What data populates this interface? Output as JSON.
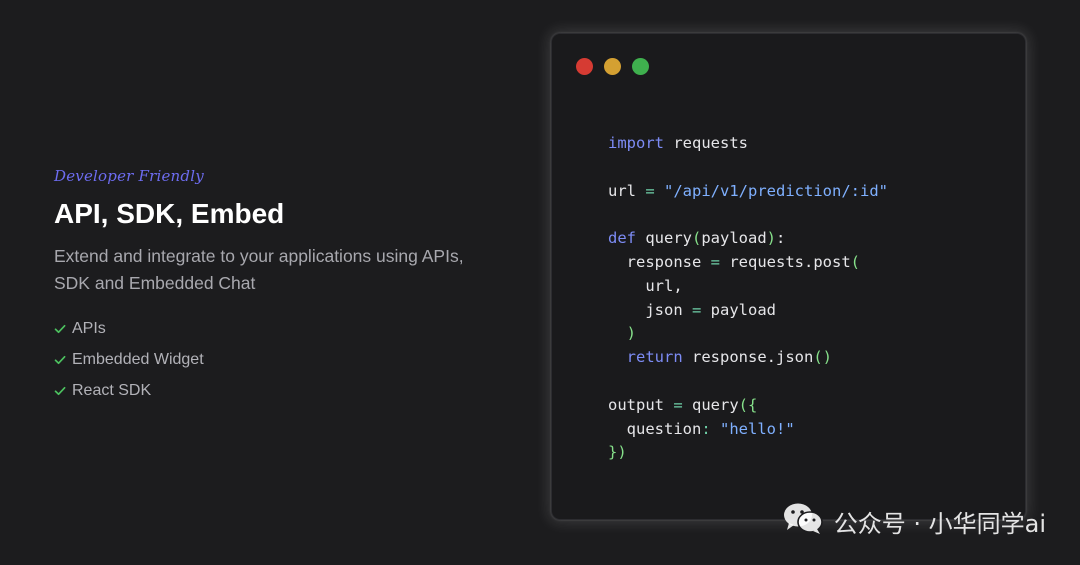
{
  "hero": {
    "eyebrow": "Developer Friendly",
    "title": "API, SDK, Embed",
    "description": "Extend and integrate to your applications using APIs, SDK and Embedded Chat",
    "features": [
      "APIs",
      "Embedded Widget",
      "React SDK"
    ]
  },
  "window": {
    "controls": [
      {
        "name": "close",
        "color": "#d63b33"
      },
      {
        "name": "minimize",
        "color": "#d4a032"
      },
      {
        "name": "maximize",
        "color": "#3fb04e"
      }
    ]
  },
  "code": {
    "lines": [
      [
        {
          "t": "import",
          "c": "kw"
        },
        {
          "t": " requests"
        }
      ],
      [],
      [
        {
          "t": "url "
        },
        {
          "t": "=",
          "c": "op"
        },
        {
          "t": " "
        },
        {
          "t": "\"/api/v1/prediction/:id\"",
          "c": "str"
        }
      ],
      [],
      [
        {
          "t": "def",
          "c": "kw"
        },
        {
          "t": " query"
        },
        {
          "t": "(",
          "c": "br"
        },
        {
          "t": "payload"
        },
        {
          "t": ")",
          "c": "br"
        },
        {
          "t": ":"
        }
      ],
      [
        {
          "t": "  response "
        },
        {
          "t": "=",
          "c": "op"
        },
        {
          "t": " requests.post"
        },
        {
          "t": "(",
          "c": "br"
        }
      ],
      [
        {
          "t": "    url,"
        }
      ],
      [
        {
          "t": "    json "
        },
        {
          "t": "=",
          "c": "op"
        },
        {
          "t": " payload"
        }
      ],
      [
        {
          "t": "  "
        },
        {
          "t": ")",
          "c": "br"
        }
      ],
      [
        {
          "t": "  "
        },
        {
          "t": "return",
          "c": "kw"
        },
        {
          "t": " response.json"
        },
        {
          "t": "()",
          "c": "br"
        }
      ],
      [],
      [
        {
          "t": "output "
        },
        {
          "t": "=",
          "c": "op"
        },
        {
          "t": " query"
        },
        {
          "t": "({",
          "c": "br"
        }
      ],
      [
        {
          "t": "  question"
        },
        {
          "t": ":",
          "c": "op"
        },
        {
          "t": " "
        },
        {
          "t": "\"hello!\"",
          "c": "str"
        }
      ],
      [
        {
          "t": "})",
          "c": "br"
        }
      ]
    ]
  },
  "watermark": {
    "text": "公众号 · 小华同学ai",
    "icon": "wechat-icon"
  }
}
